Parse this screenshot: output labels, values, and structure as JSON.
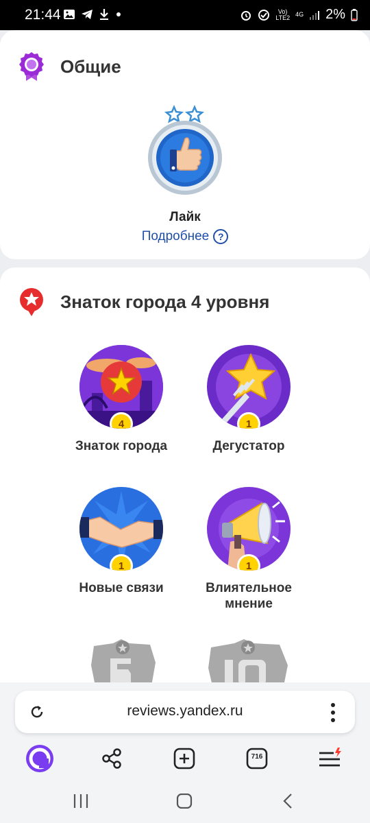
{
  "status_bar": {
    "time": "21:44",
    "battery": "2%",
    "network_top": "Vo)",
    "network_bottom": "LTE2",
    "network_type": "4G",
    "icons": [
      "image-icon",
      "telegram-icon",
      "download-icon",
      "dot-icon",
      "alarm-icon",
      "signal-icon",
      "battery-icon"
    ]
  },
  "general_section": {
    "title": "Общие",
    "icon": "medal-icon",
    "badge_name": "Лайк",
    "more_link": "Подробнее",
    "help_mark": "?"
  },
  "city_section": {
    "title": "Знаток города 4 уровня",
    "icon": "city-pin-icon",
    "badges": [
      {
        "name": "Знаток города",
        "level": "4"
      },
      {
        "name": "Дегустатор",
        "level": "1"
      },
      {
        "name": "Новые связи",
        "level": "1"
      },
      {
        "name": "Влиятельное мнение",
        "level": "1"
      }
    ]
  },
  "browser": {
    "url": "reviews.yandex.ru",
    "tabs_count": "716",
    "icons": [
      "reload-icon",
      "more-vertical-icon",
      "alice-icon",
      "share-icon",
      "new-tab-icon",
      "tabs-icon",
      "menu-icon"
    ]
  },
  "colors": {
    "accent_purple": "#9b2bd6",
    "link_blue": "#1f4fa8",
    "level_gold": "#ffd200",
    "pin_red": "#e62c2c"
  }
}
